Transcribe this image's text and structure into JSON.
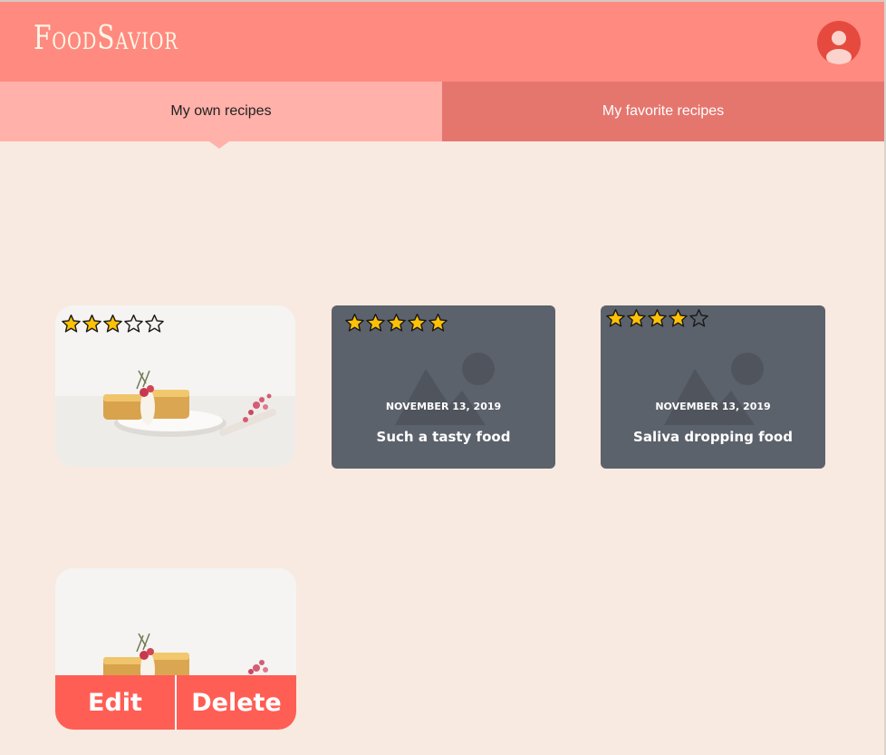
{
  "app": {
    "logo": "FoodSavior"
  },
  "tabs": [
    {
      "label": "My own recipes",
      "active": true
    },
    {
      "label": "My favorite recipes",
      "active": false
    }
  ],
  "recipes": [
    {
      "type": "photo",
      "rating": 3,
      "max_rating": 5
    },
    {
      "type": "placeholder",
      "rating": 5,
      "max_rating": 5,
      "date": "NOVEMBER 13, 2019",
      "title": "Such a tasty food"
    },
    {
      "type": "placeholder",
      "rating": 4,
      "max_rating": 5,
      "date": "NOVEMBER 13, 2019",
      "title": "Saliva dropping food"
    },
    {
      "type": "photo",
      "actions": {
        "edit": "Edit",
        "delete": "Delete"
      }
    }
  ],
  "colors": {
    "header": "#ff8a80",
    "tab_active": "#ffb1aa",
    "tab_inactive": "#e5766e",
    "background": "#f8eae0",
    "placeholder_card": "#5c626c",
    "action_bar": "#ff5e55",
    "star_fill": "#ffc107",
    "avatar": "#e64a3e"
  }
}
